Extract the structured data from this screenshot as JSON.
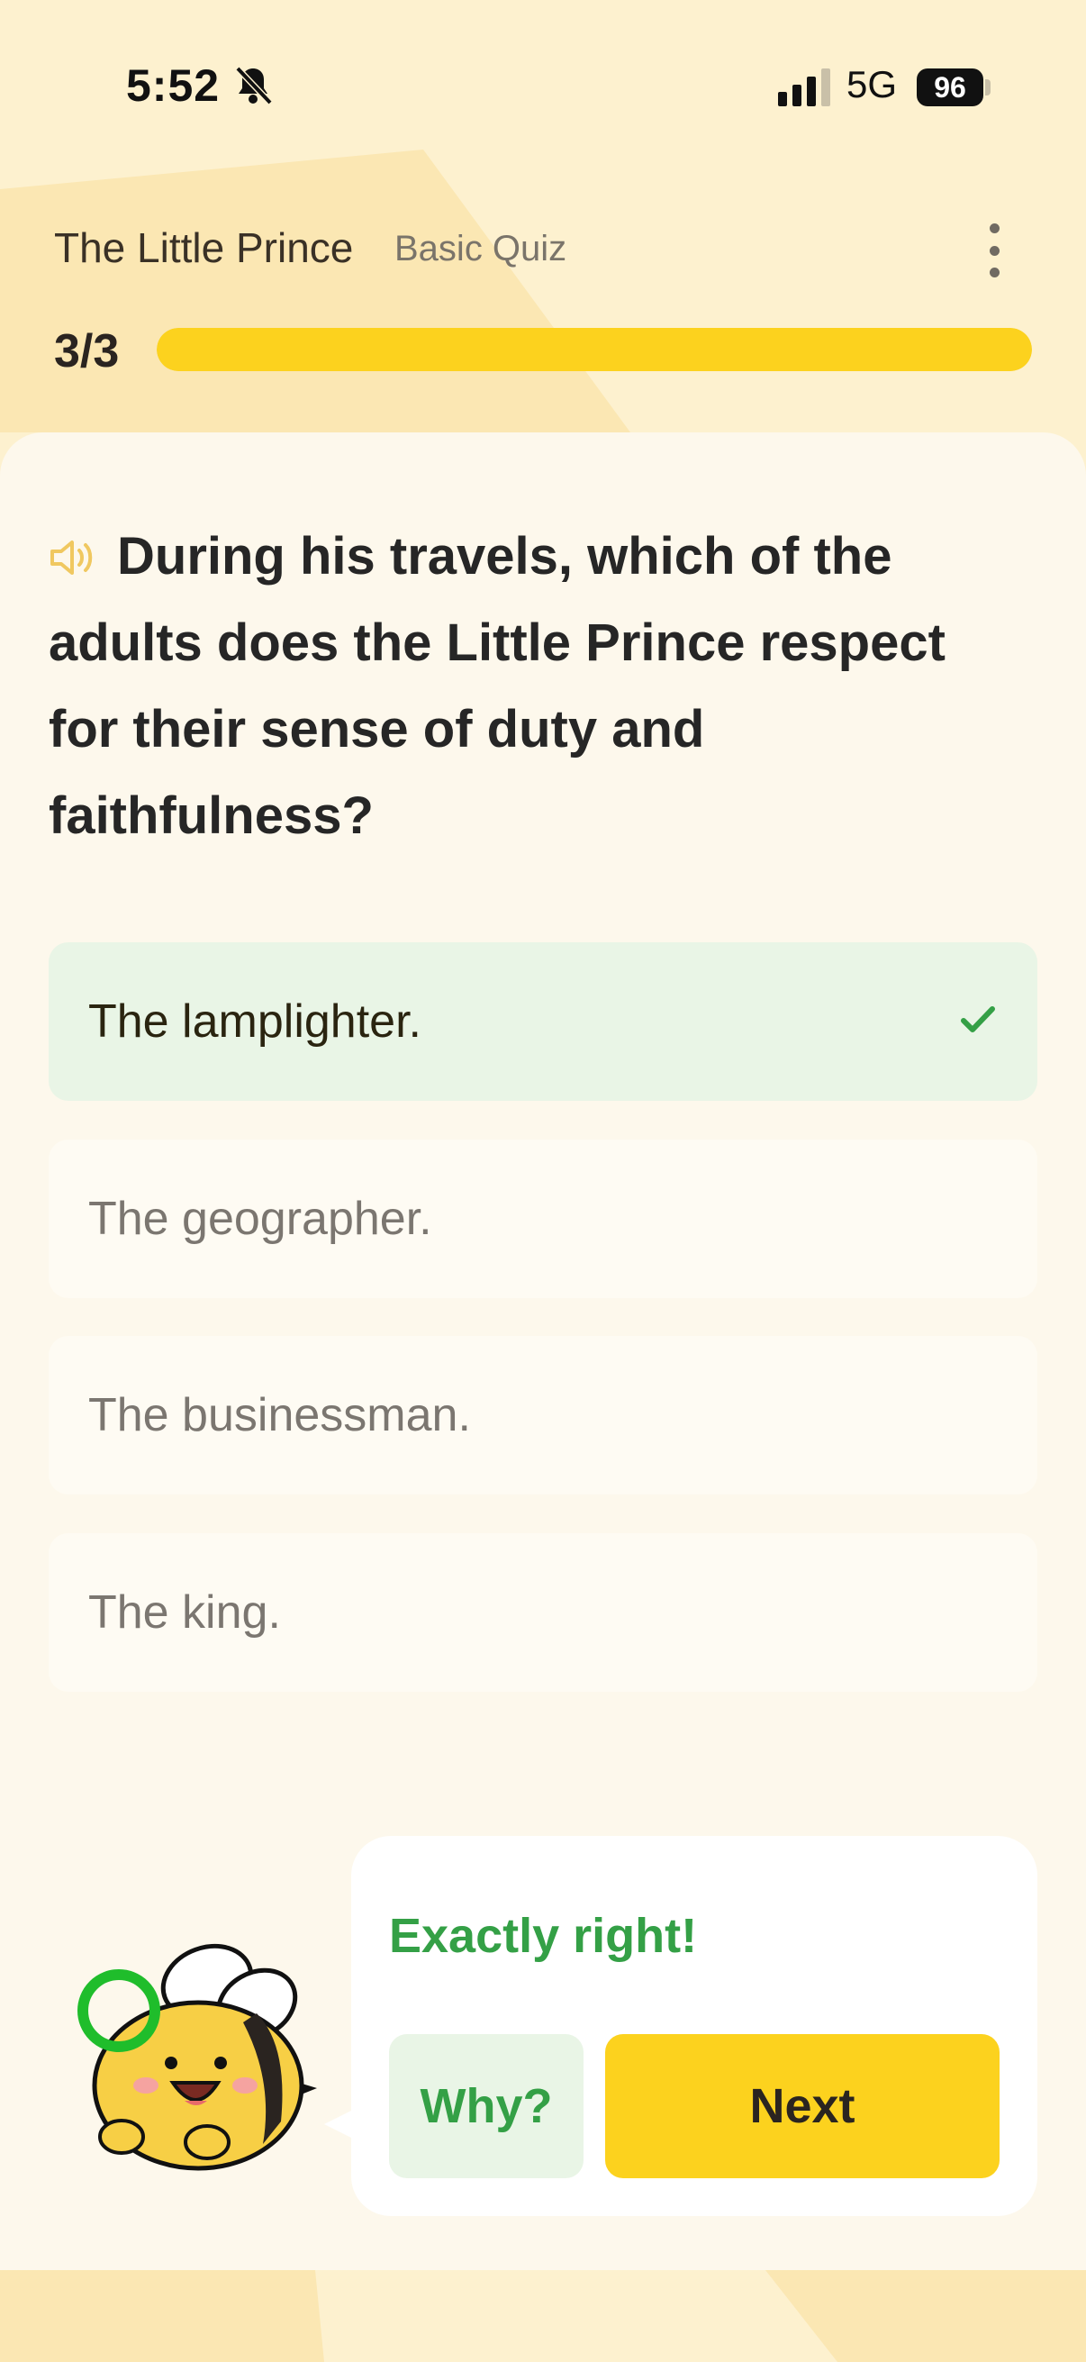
{
  "status_bar": {
    "time": "5:52",
    "network": "5G",
    "battery": "96"
  },
  "header": {
    "title": "The Little Prince",
    "subtitle": "Basic Quiz"
  },
  "progress": {
    "label": "3/3",
    "fraction": 1.0
  },
  "question": {
    "text": "During his travels, which of the adults does the Little Prince respect for their sense of duty and faithfulness?"
  },
  "options": [
    {
      "label": "The lamplighter.",
      "state": "correct"
    },
    {
      "label": "The geographer.",
      "state": "default"
    },
    {
      "label": "The businessman.",
      "state": "default"
    },
    {
      "label": "The king.",
      "state": "default"
    }
  ],
  "feedback": {
    "message": "Exactly right!",
    "why_label": "Why?",
    "next_label": "Next"
  },
  "colors": {
    "accent_yellow": "#fcd21e",
    "success_green": "#34a046",
    "correct_bg": "#e9f5e6",
    "background": "#fdf1cf"
  }
}
